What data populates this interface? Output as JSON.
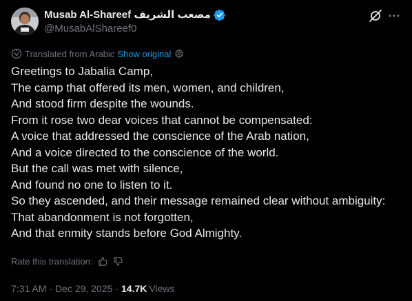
{
  "author": {
    "display_name": "Musab Al-Shareef مصعب الشريف",
    "handle": "@MusabAlShareef0",
    "verified": true
  },
  "header_icons": [
    "grok-icon",
    "more-icon"
  ],
  "translation": {
    "notice": "Translated from Arabic",
    "show_original_label": "Show original"
  },
  "tweet": {
    "lines": [
      "Greetings to Jabalia Camp,",
      "The camp that offered its men, women, and children,",
      "And stood firm despite the wounds.",
      "From it rose two dear voices that cannot be compensated:",
      "A voice that addressed the conscience of the Arab nation,",
      "And a voice directed to the conscience of the world.",
      "But the call was met with silence,",
      "And found no one to listen to it.",
      "So they ascended, and their message remained clear without ambiguity:",
      "That abandonment is not forgotten,",
      "And that enmity stands before God Almighty."
    ]
  },
  "rating": {
    "label": "Rate this translation:"
  },
  "meta": {
    "time": "7:31 AM",
    "separator": "·",
    "date": "Dec 29, 2025",
    "views_count": "14.7K",
    "views_label": "Views"
  },
  "colors": {
    "background": "#000000",
    "text_primary": "#e7e9ea",
    "text_secondary": "#71767b",
    "accent": "#1d9bf0"
  }
}
